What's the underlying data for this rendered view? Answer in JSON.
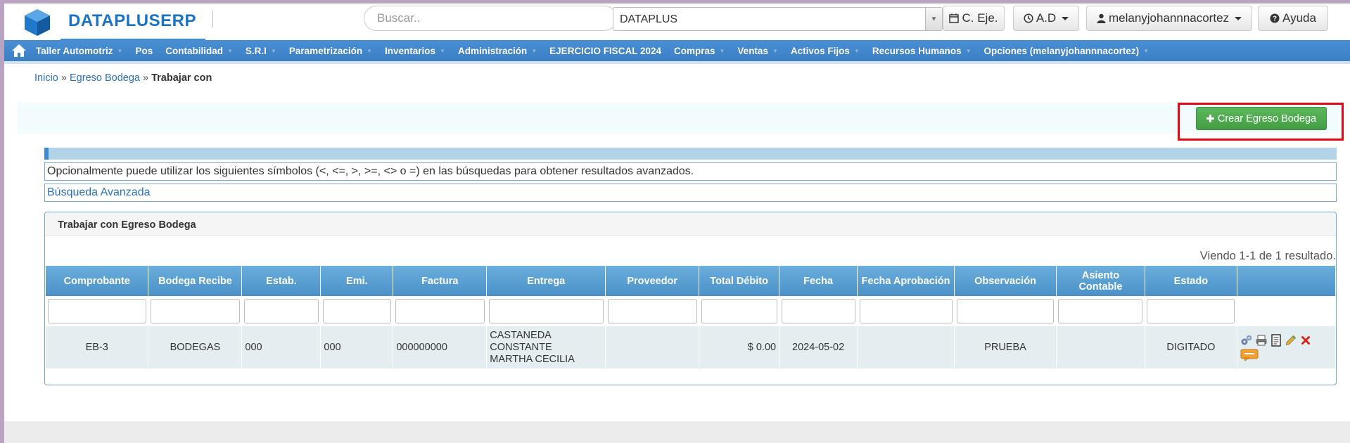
{
  "header": {
    "brand": "DATAPLUSERP",
    "search_placeholder": "Buscar..",
    "company": "DATAPLUS",
    "buttons": {
      "c_eje": "C. Eje.",
      "ad": "A.D",
      "user": "melanyjohannnacortez",
      "help": "Ayuda"
    }
  },
  "nav": {
    "items": [
      "Taller Automotriz",
      "Pos",
      "Contabilidad",
      "S.R.I",
      "Parametrización",
      "Inventarios",
      "Administración",
      "EJERCICIO FISCAL 2024",
      "Compras",
      "Ventas",
      "Activos Fijos",
      "Recursos Humanos",
      "Opciones (melanyjohannnacortez)"
    ]
  },
  "breadcrumb": {
    "home": "Inicio",
    "section": "Egreso Bodega",
    "current": "Trabajar con",
    "sep": "»"
  },
  "actions": {
    "create": "Crear Egreso Bodega"
  },
  "info": {
    "hint": "Opcionalmente puede utilizar los siguientes símbolos (<, <=, >, >=, <> o =) en las búsquedas para obtener resultados avanzados.",
    "advanced": "Búsqueda Avanzada"
  },
  "panel": {
    "title": "Trabajar con Egreso Bodega",
    "summary": "Viendo 1-1 de 1 resultado."
  },
  "table": {
    "headers": [
      "Comprobante",
      "Bodega Recibe",
      "Estab.",
      "Emi.",
      "Factura",
      "Entrega",
      "Proveedor",
      "Total Débito",
      "Fecha",
      "Fecha Aprobación",
      "Observación",
      "Asiento Contable",
      "Estado"
    ],
    "rows": [
      {
        "comprobante": "EB-3",
        "bodega": "BODEGAS",
        "estab": "000",
        "emi": "000",
        "factura": "000000000",
        "entrega_1": "CASTANEDA",
        "entrega_2": "CONSTANTE",
        "entrega_3": "MARTHA CECILIA",
        "proveedor": "",
        "total": "$ 0.00",
        "fecha": "2024-05-02",
        "fecha_aprob": "",
        "observacion": "PRUEBA",
        "asiento": "",
        "estado": "DIGITADO"
      }
    ]
  },
  "colors": {
    "brand": "#1b73c3",
    "nav": "#3b7fc4",
    "create": "#5cb85c",
    "highlight": "#e30613"
  }
}
